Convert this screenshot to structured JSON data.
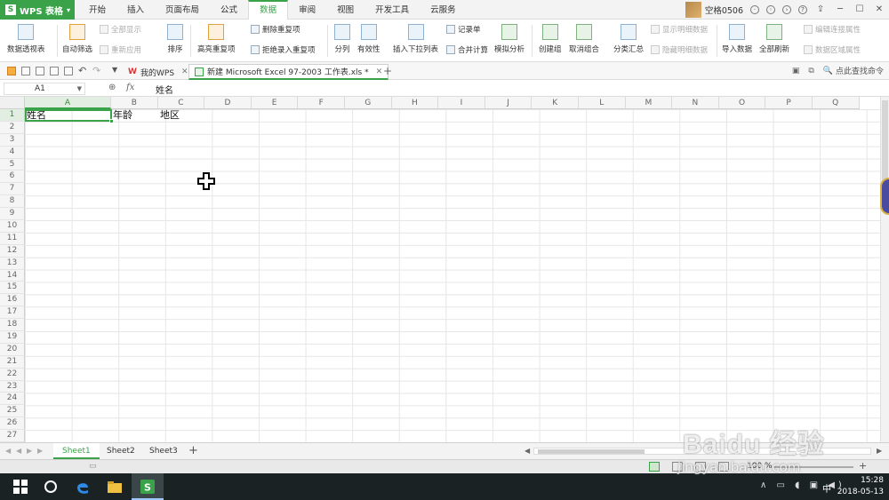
{
  "app": {
    "logo_letter": "S",
    "menu_label": "WPS 表格"
  },
  "menu_tabs": [
    "开始",
    "插入",
    "页面布局",
    "公式",
    "数据",
    "审阅",
    "视图",
    "开发工具",
    "云服务"
  ],
  "active_menu_tab": "数据",
  "user": {
    "name": "空格0506"
  },
  "ribbon": {
    "pivot": "数据透视表",
    "autofilter": "自动筛选",
    "show_all": "全部显示",
    "reapply": "重新应用",
    "sort_label": "排序",
    "highlight_dup": "高亮重复项",
    "delete_dup": "删除重复项",
    "reject_dup": "拒绝录入重复项",
    "split": "分列",
    "validity": "有效性",
    "dropdown_list": "插入下拉列表",
    "record": "记录单",
    "consolidate": "合并计算",
    "simulate": "模拟分析",
    "group": "创建组",
    "ungroup": "取消组合",
    "subtotal": "分类汇总",
    "show_detail": "显示明细数据",
    "hide_detail": "隐藏明细数据",
    "import": "导入数据",
    "refresh_all": "全部刷新",
    "edit_link": "编辑连接属性",
    "range_props": "数据区域属性"
  },
  "doc_tabs": [
    {
      "label": "我的WPS",
      "active": false
    },
    {
      "label": "新建 Microsoft Excel 97-2003 工作表.xls *",
      "active": true
    }
  ],
  "find_placeholder": "点此查找命令",
  "formula_bar": {
    "cell_ref": "A1",
    "fx": "fx",
    "value": "姓名"
  },
  "columns": [
    "A",
    "B",
    "C",
    "D",
    "E",
    "F",
    "G",
    "H",
    "I",
    "J",
    "K",
    "L",
    "M",
    "N",
    "O",
    "P",
    "Q"
  ],
  "rows": [
    "1",
    "2",
    "3",
    "4",
    "5",
    "6",
    "7",
    "8",
    "9",
    "10",
    "11",
    "12",
    "13",
    "14",
    "15",
    "16",
    "17",
    "18",
    "19",
    "20",
    "21",
    "22",
    "23",
    "24",
    "25",
    "26",
    "27"
  ],
  "cells": {
    "A1": "姓名",
    "B1": "年龄",
    "C1": "地区"
  },
  "sheets": [
    "Sheet1",
    "Sheet2",
    "Sheet3"
  ],
  "active_sheet": "Sheet1",
  "status": {
    "zoom": "100 %"
  },
  "taskbar": {
    "time": "15:28",
    "date": "2018-05-13",
    "ime": "中"
  },
  "watermark": {
    "main": "Baidu 经验",
    "sub": "jingyan.baidu.com"
  },
  "colors": {
    "accent": "#3aa34a"
  }
}
